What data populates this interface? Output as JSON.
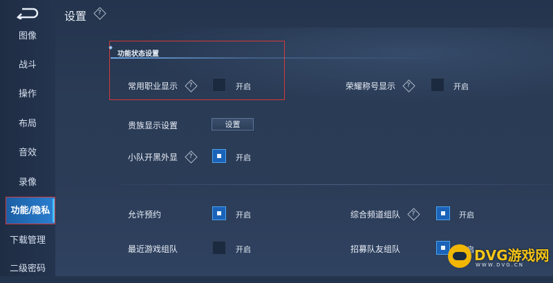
{
  "title": "设置",
  "sidebar": {
    "items": [
      {
        "label": "图像"
      },
      {
        "label": "战斗"
      },
      {
        "label": "操作"
      },
      {
        "label": "布局"
      },
      {
        "label": "音效"
      },
      {
        "label": "录像"
      },
      {
        "label": "功能/隐私"
      },
      {
        "label": "下载管理"
      },
      {
        "label": "二级密码"
      }
    ],
    "active": "功能/隐私"
  },
  "section": {
    "title": "功能状态设置"
  },
  "settings": {
    "common_job": {
      "label": "常用职业显示",
      "state": "开启",
      "checked": false
    },
    "honor_title": {
      "label": "荣耀称号显示",
      "state": "开启",
      "checked": false
    },
    "noble": {
      "label": "贵族显示设置",
      "button": "设置"
    },
    "team_black": {
      "label": "小队开黑外显",
      "state": "开启",
      "checked": true
    },
    "allow_reserve": {
      "label": "允许预约",
      "state": "开启",
      "checked": true
    },
    "channel_team": {
      "label": "综合频道组队",
      "state": "开启",
      "checked": true
    },
    "recent_team": {
      "label": "最近游戏组队",
      "state": "开启",
      "checked": false
    },
    "recruit_team": {
      "label": "招募队友组队",
      "state": "开启",
      "checked": true
    }
  },
  "watermark": {
    "text": "DVG游戏网",
    "sub": "WWW.DVG.CN"
  },
  "colors": {
    "accent": "#1a63b8",
    "highlight_box": "#d63a3a"
  }
}
